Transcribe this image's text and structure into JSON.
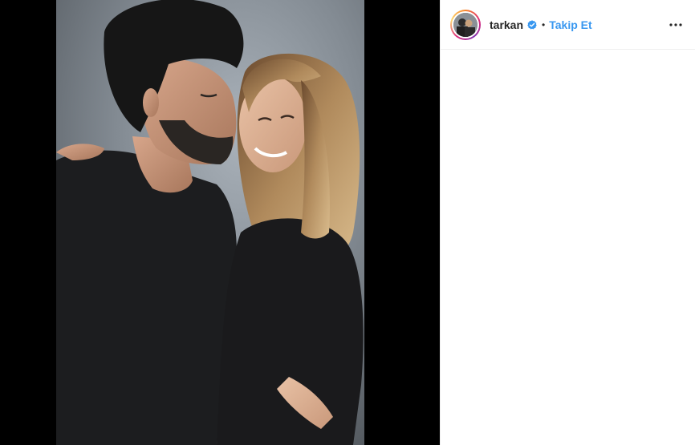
{
  "post": {
    "author": {
      "username": "tarkan",
      "verified": true,
      "follow_label": "Takip Et",
      "separator": "•"
    },
    "icons": {
      "verified": "verified-badge-icon",
      "more": "more-options-icon"
    },
    "colors": {
      "follow": "#3897f0",
      "verified": "#3897f0",
      "media_background": "#000000"
    }
  }
}
